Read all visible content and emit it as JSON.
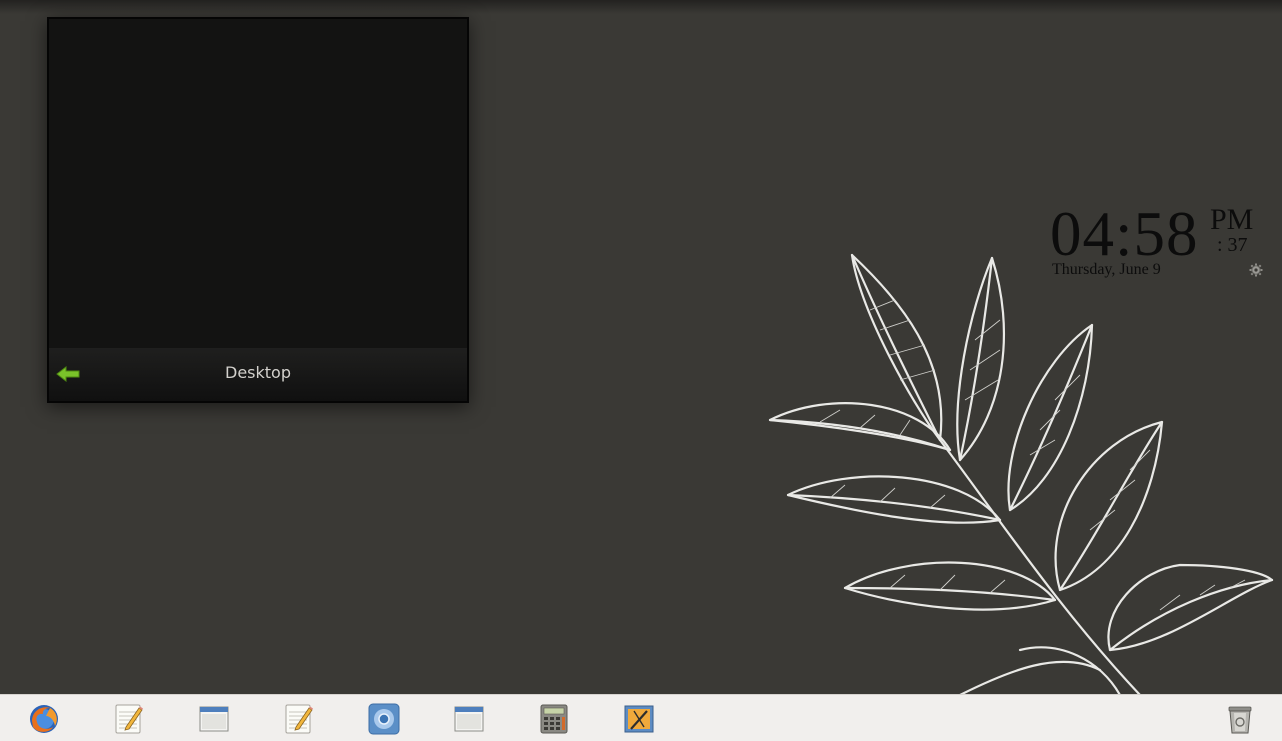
{
  "desktop_switcher": {
    "title": "Desktop",
    "back_icon": "back-arrow-icon"
  },
  "clock": {
    "time": "04:58",
    "ampm": "PM",
    "seconds": ": 37",
    "date": "Thursday, June 9",
    "settings_icon": "gear-icon"
  },
  "dock": {
    "items": [
      {
        "icon": "firefox-icon"
      },
      {
        "icon": "text-editor-icon"
      },
      {
        "icon": "window-icon"
      },
      {
        "icon": "text-editor-icon"
      },
      {
        "icon": "chromium-icon"
      },
      {
        "icon": "window-icon"
      },
      {
        "icon": "calculator-icon"
      },
      {
        "icon": "screenshot-tool-icon"
      },
      {
        "icon": "trash-icon"
      }
    ]
  },
  "colors": {
    "desktop_background": "#3a3935",
    "dock_background": "#f1efed",
    "switcher_background": "#121211",
    "back_arrow": "#7ac22a"
  }
}
